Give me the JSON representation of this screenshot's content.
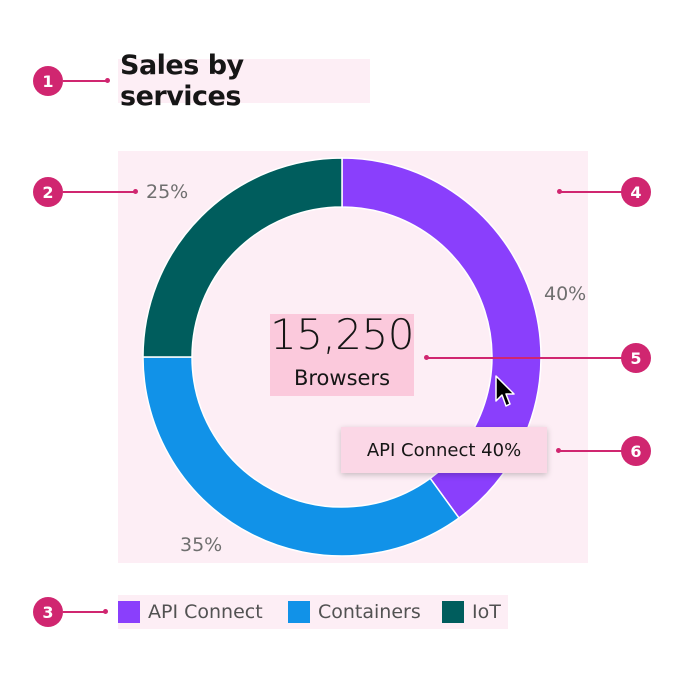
{
  "annotations": [
    "1",
    "2",
    "3",
    "4",
    "5",
    "6"
  ],
  "chart_data": {
    "type": "pie",
    "title": "Sales by services",
    "center": {
      "value": "15,250",
      "label": "Browsers"
    },
    "categories": [
      "API Connect",
      "Containers",
      "IoT"
    ],
    "values": [
      40,
      35,
      25
    ],
    "value_labels": [
      "40%",
      "35%",
      "25%"
    ],
    "colors": [
      "#8a3ffc",
      "#1192e8",
      "#005d5d"
    ],
    "legend": {
      "placement": "bottom-left",
      "items": [
        "API Connect",
        "Containers",
        "IoT"
      ]
    },
    "tooltip": "API Connect 40%"
  }
}
